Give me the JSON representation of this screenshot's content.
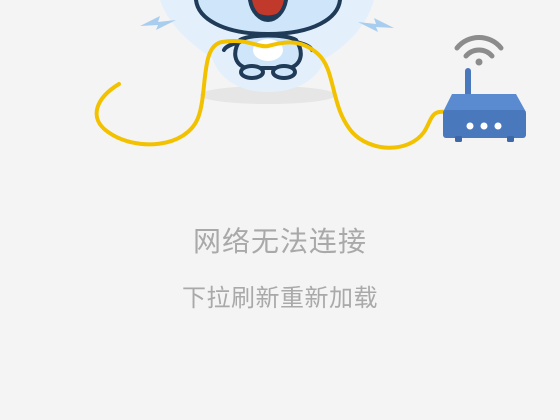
{
  "error": {
    "title": "网络无法连接",
    "reload_hint": "下拉刷新重新加载"
  },
  "illustration": {
    "mascot": "shocked-blue-mascot",
    "router": "wifi-router-icon",
    "colors": {
      "mascot_fill": "#cfe6fa",
      "mascot_glow": "#e3f0fb",
      "mascot_outline": "#1f3b57",
      "cable": "#f2c200",
      "router_body": "#4a78bd",
      "router_top": "#5a8bd0",
      "wifi_signal": "#8c8c8c",
      "shadow": "#e6e6e6"
    }
  }
}
